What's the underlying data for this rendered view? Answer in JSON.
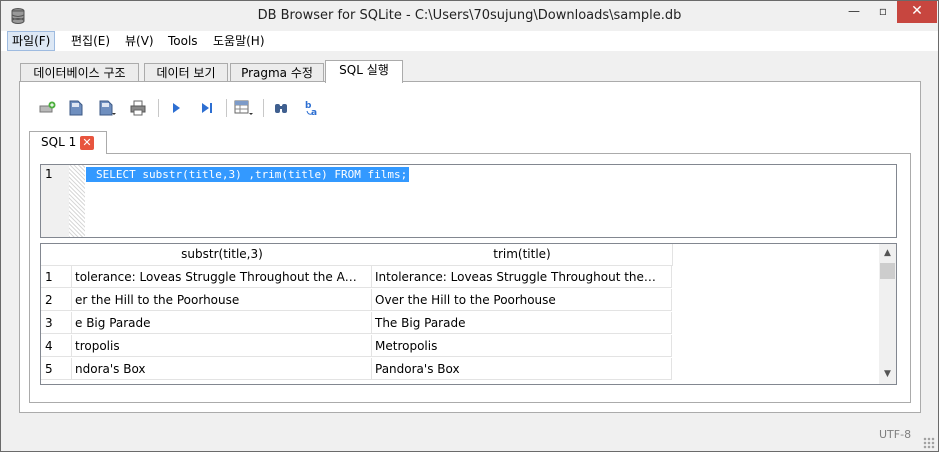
{
  "window": {
    "title": "DB Browser for SQLite - C:\\Users\\70sujung\\Downloads\\sample.db",
    "min": "—",
    "max": "▫",
    "close": "✕"
  },
  "menu": [
    "파일(F)",
    "편집(E)",
    "뷰(V)",
    "Tools",
    "도움말(H)"
  ],
  "tabs": [
    "데이터베이스 구조",
    "데이터 보기",
    "Pragma 수정",
    "SQL 실행"
  ],
  "active_tab": "SQL 실행",
  "toolbar_icons": [
    "open-tab-icon",
    "open-sql-icon",
    "save-sql-icon",
    "print-icon",
    "execute-all-icon",
    "execute-line-icon",
    "save-results-icon",
    "find-icon",
    "find-replace-icon"
  ],
  "sql_tab": {
    "label": "SQL 1",
    "close": "✕"
  },
  "editor": {
    "line_number": "1",
    "sql": "SELECT substr(title,3) ,trim(title) FROM films;"
  },
  "results": {
    "columns": [
      "substr(title,3)",
      "trim(title)"
    ],
    "rows": [
      {
        "n": "1",
        "c1": "tolerance: Loveas Struggle Throughout the A…",
        "c2": "Intolerance: Loveas Struggle Throughout the…"
      },
      {
        "n": "2",
        "c1": "er the Hill to the Poorhouse",
        "c2": "Over the Hill to the Poorhouse"
      },
      {
        "n": "3",
        "c1": "e Big Parade",
        "c2": "The Big Parade"
      },
      {
        "n": "4",
        "c1": "tropolis",
        "c2": "Metropolis"
      },
      {
        "n": "5",
        "c1": "ndora's Box",
        "c2": "Pandora's Box"
      }
    ]
  },
  "status": {
    "encoding": "UTF-8"
  },
  "colors": {
    "selection": "#3399ff",
    "close_button": "#c7463f",
    "tab_close": "#e8553e"
  }
}
